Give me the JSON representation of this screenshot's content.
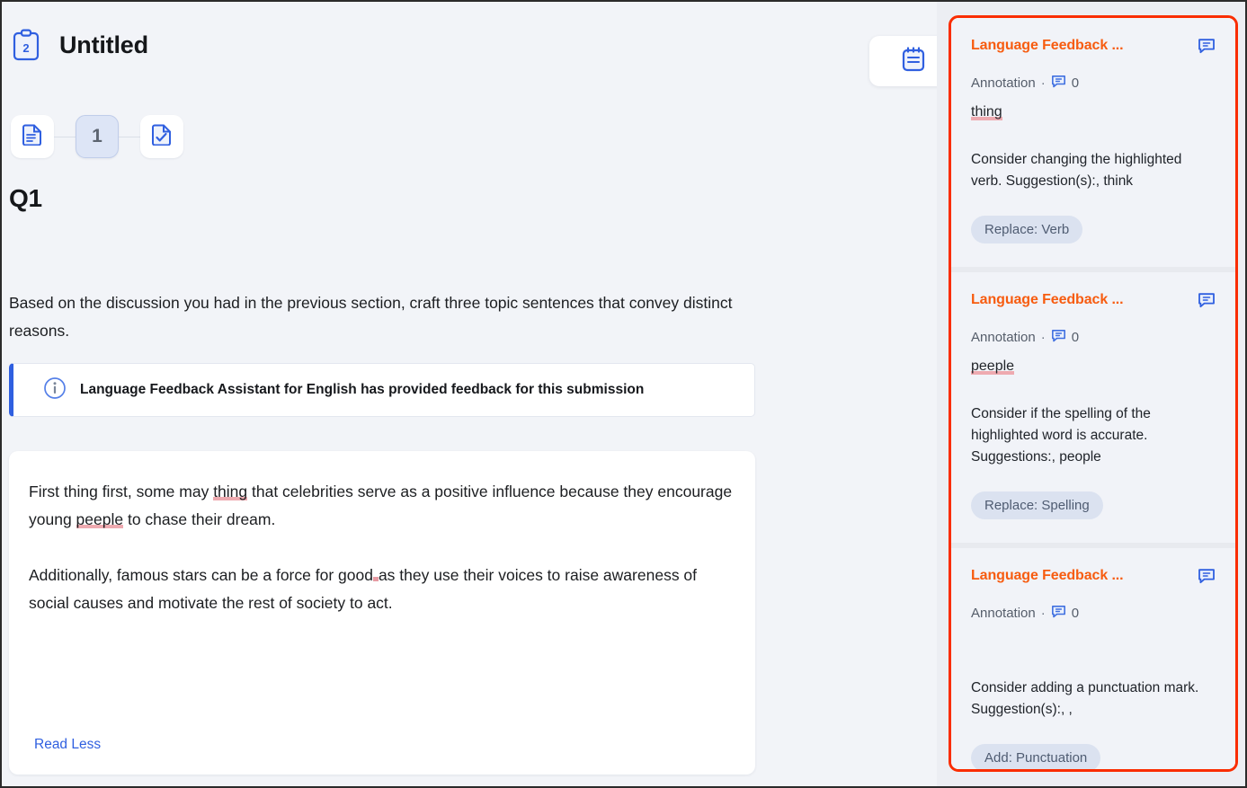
{
  "document": {
    "title": "Untitled",
    "clipboard_badge": "2",
    "steps": [
      {
        "name": "document-step",
        "label": "",
        "icon": "document-lines-icon",
        "active": false
      },
      {
        "name": "question-step",
        "label": "1",
        "icon": "number-badge",
        "active": true
      },
      {
        "name": "review-step",
        "label": "",
        "icon": "document-check-icon",
        "active": false
      }
    ],
    "question_label": "Q1",
    "prompt": "Based on the discussion you had in the previous section, craft three topic sentences that convey distinct reasons.",
    "banner": {
      "icon": "info-icon",
      "text": "Language Feedback Assistant for English has provided feedback for this submission"
    },
    "submission": {
      "paragraph1_pre": "First thing first, some may ",
      "paragraph1_err": "thing",
      "paragraph1_post": " that celebrities serve as a positive influence because they encourage young ",
      "paragraph1_err2": "peeple",
      "paragraph1_post2": " to chase their dream.",
      "paragraph2_pre": "Additionally, famous stars can be a force for good",
      "paragraph2_post": "as they use their voices to raise awareness of social causes and motivate the rest of society to act.",
      "read_less_label": "Read Less"
    },
    "notebook_button": "notebook-icon"
  },
  "sidebar": {
    "highlight_color": "#fa2d00",
    "accent_color": "#f75c10",
    "cards": [
      {
        "title": "Language Feedback ...",
        "type_label": "Annotation",
        "separator": "·",
        "comment_count": "0",
        "highlighted_word": "thing",
        "body": "Consider changing the highlighted verb. Suggestion(s):, think",
        "chip": "Replace: Verb",
        "bubble_icon": "speech-bubble-icon"
      },
      {
        "title": "Language Feedback ...",
        "type_label": "Annotation",
        "separator": "·",
        "comment_count": "0",
        "highlighted_word": "peeple",
        "body": "Consider if the spelling of the highlighted word is accurate. Suggestions:, people",
        "chip": "Replace: Spelling",
        "bubble_icon": "speech-bubble-icon"
      },
      {
        "title": "Language Feedback ...",
        "type_label": "Annotation",
        "separator": "·",
        "comment_count": "0",
        "highlighted_word": "",
        "body": "Consider adding a punctuation mark. Suggestion(s):, ,",
        "chip": "Add: Punctuation",
        "bubble_icon": "speech-bubble-icon"
      }
    ]
  }
}
